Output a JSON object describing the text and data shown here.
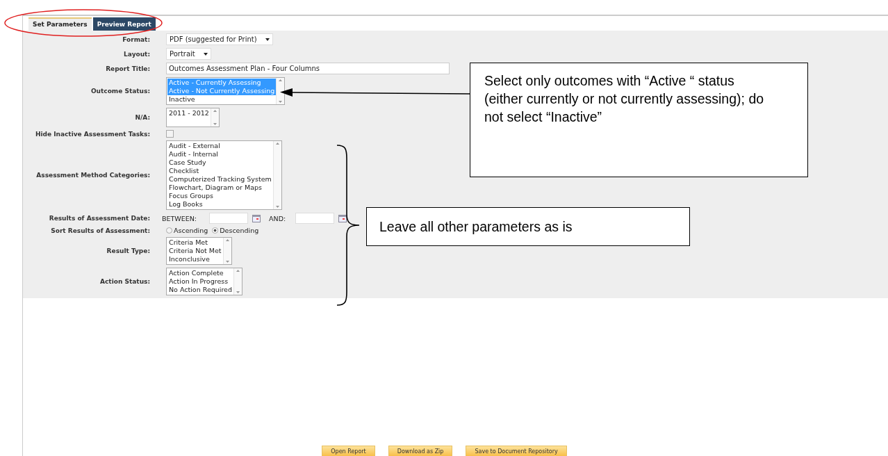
{
  "tabs": [
    {
      "label": "Set Parameters",
      "selected": true
    },
    {
      "label": "Preview Report",
      "selected": false
    }
  ],
  "fields": [
    {
      "kind": "select",
      "label": "Format:",
      "value": "PDF (suggested for Print)"
    },
    {
      "kind": "select",
      "label": "Layout:",
      "value": "Portrait"
    },
    {
      "kind": "text",
      "label": "Report Title:",
      "value": "Outcomes Assessment Plan - Four Columns"
    },
    {
      "kind": "listbox",
      "label": "Outcome Status:",
      "options": [
        {
          "label": "Active - Currently Assessing",
          "selected": true
        },
        {
          "label": "Active - Not Currently Assessing",
          "selected": true
        },
        {
          "label": "Inactive",
          "selected": false
        }
      ]
    },
    {
      "kind": "listbox",
      "label": "N/A:",
      "options": [
        {
          "label": "2011 - 2012",
          "selected": false
        }
      ]
    },
    {
      "kind": "checkbox",
      "label": "Hide Inactive Assessment Tasks:",
      "checked": false
    },
    {
      "kind": "listbox",
      "label": "Assessment Method Categories:",
      "options": [
        {
          "label": "Audit - External",
          "selected": false
        },
        {
          "label": "Audit - Internal",
          "selected": false
        },
        {
          "label": "Case Study",
          "selected": false
        },
        {
          "label": "Checklist",
          "selected": false
        },
        {
          "label": "Computerized Tracking System",
          "selected": false
        },
        {
          "label": "Flowchart, Diagram or Maps",
          "selected": false
        },
        {
          "label": "Focus Groups",
          "selected": false
        },
        {
          "label": "Log Books",
          "selected": false
        }
      ]
    },
    {
      "kind": "daterange",
      "label": "Results of Assessment Date:",
      "from_label": "BETWEEN:",
      "to_label": "AND:"
    },
    {
      "kind": "radio",
      "label": "Sort Results of Assessment:",
      "options": [
        {
          "label": "Ascending",
          "selected": false
        },
        {
          "label": "Descending",
          "selected": true
        }
      ]
    },
    {
      "kind": "listbox",
      "label": "Result Type:",
      "options": [
        {
          "label": "Criteria Met",
          "selected": false
        },
        {
          "label": "Criteria Not Met",
          "selected": false
        },
        {
          "label": "Inconclusive",
          "selected": false
        }
      ]
    },
    {
      "kind": "listbox",
      "label": "Action Status:",
      "options": [
        {
          "label": "Action Complete",
          "selected": false
        },
        {
          "label": "Action In Progress",
          "selected": false
        },
        {
          "label": "No Action Required",
          "selected": false
        }
      ]
    }
  ],
  "buttons": [
    "Open Report",
    "Download as Zip",
    "Save to Document Repository"
  ],
  "annotations": [
    {
      "kind": "arrow",
      "text": "Select only outcomes with “Active “ status (either currently or not currently assessing); do not select “Inactive”"
    },
    {
      "kind": "brace",
      "text": "Leave all other parameters as is"
    }
  ]
}
